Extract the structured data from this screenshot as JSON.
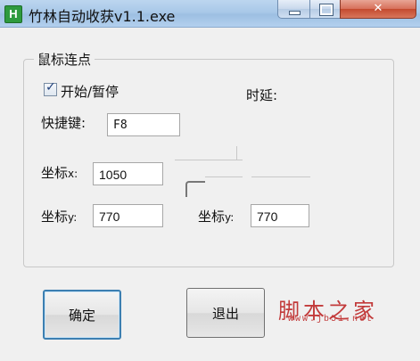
{
  "window": {
    "title": "竹林自动收获v1.1.exe",
    "app_icon_letter": "H",
    "controls": {
      "minimize_icon": "minimize-icon",
      "maximize_icon": "maximize-icon",
      "close_glyph": "✕"
    }
  },
  "group": {
    "title": "鼠标连点",
    "start_pause": {
      "label": "开始/暂停",
      "checked": true
    },
    "delay_label": "时延:",
    "hotkey": {
      "label": "快捷键:",
      "value": "F8"
    },
    "coord_x": {
      "label_main": "坐标",
      "label_suffix": "x:",
      "value": "1050"
    },
    "coord_y1": {
      "label_main": "坐标",
      "label_suffix": "y:",
      "value": "770"
    },
    "coord_y2": {
      "label_main": "坐标",
      "label_suffix": "y:",
      "value": "770"
    }
  },
  "buttons": {
    "ok": "确定",
    "exit": "退出"
  },
  "watermark": {
    "text": "脚本之家",
    "url": "www.jb51.net"
  },
  "colors": {
    "titlebar": "#a9c8e8",
    "close_button": "#c44a2f",
    "default_button_border": "#3c7fb1",
    "watermark": "#c23a3a"
  }
}
